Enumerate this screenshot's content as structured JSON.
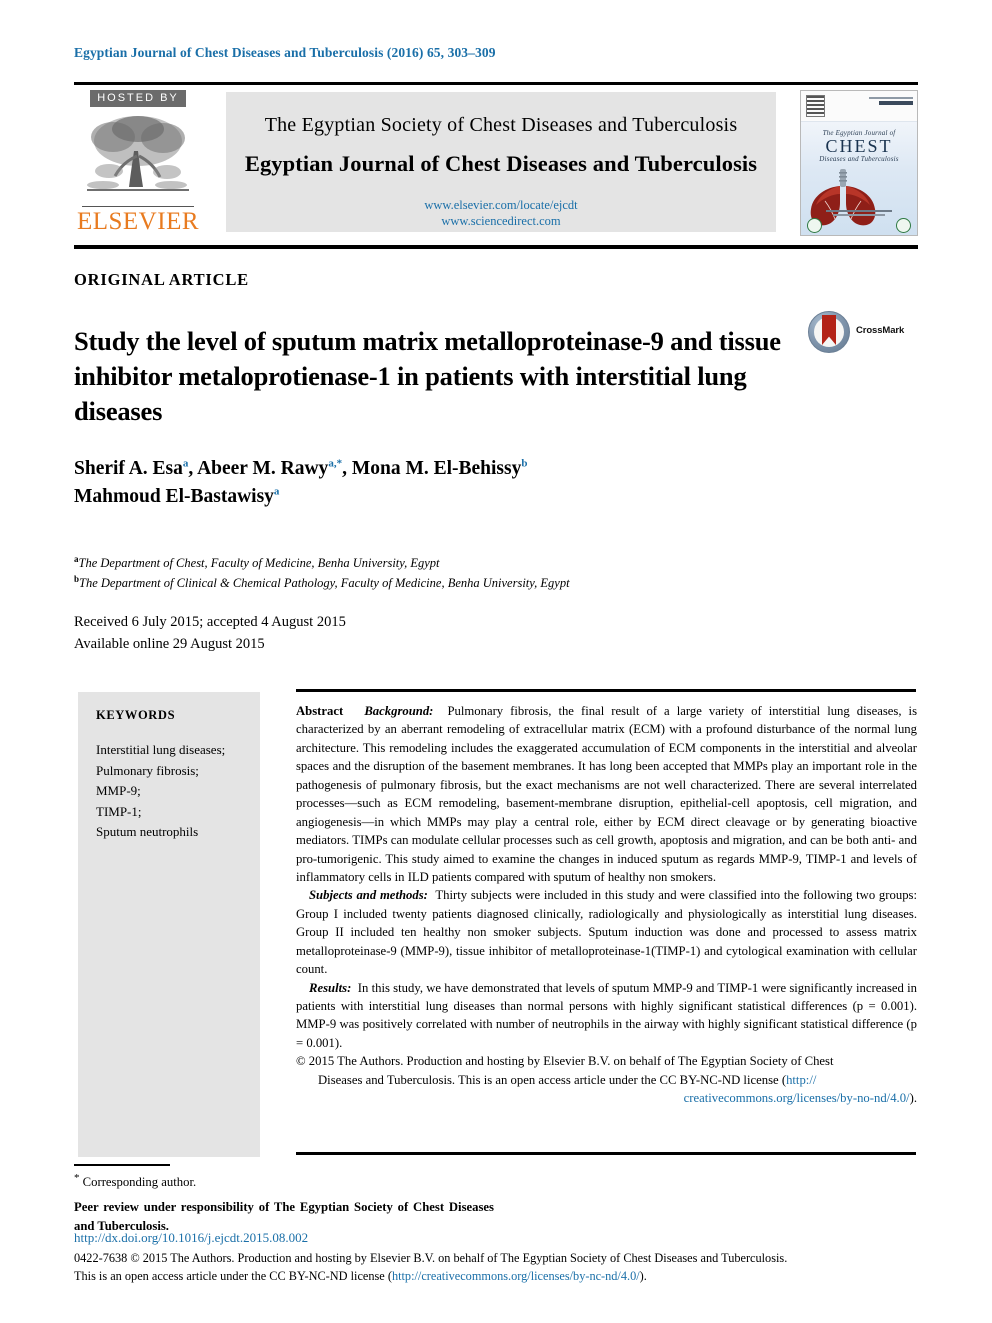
{
  "running_head": "Egyptian Journal of Chest Diseases and Tuberculosis (2016) 65, 303–309",
  "masthead": {
    "hosted_by": "HOSTED BY",
    "publisher": "ELSEVIER",
    "society_line": "The Egyptian Society of Chest Diseases and Tuberculosis",
    "journal_title": "Egyptian Journal of Chest Diseases and Tuberculosis",
    "link_locate": "www.elsevier.com/locate/ejcdt",
    "link_sciencedirect": "www.sciencedirect.com",
    "cover": {
      "line1": "The Egyptian Journal of",
      "line2": "CHEST",
      "line3": "Diseases and Tuberculosis"
    }
  },
  "article": {
    "type": "ORIGINAL ARTICLE",
    "title": "Study the level of sputum matrix metalloproteinase-9 and tissue inhibitor metaloprotienase-1 in patients with interstitial lung diseases",
    "crossmark_label": "CrossMark",
    "authors_line1_a": "Sherif A. Esa",
    "authors_line1_a_sup": "a",
    "authors_line1_b": ", Abeer M. Rawy",
    "authors_line1_b_sup": "a,*",
    "authors_line1_c": ", Mona M. El-Behissy",
    "authors_line1_c_sup": "b",
    "authors_line2": "Mahmoud El-Bastawisy",
    "authors_line2_sup": "a",
    "affiliation_a_sup": "a",
    "affiliation_a": "The Department of Chest, Faculty of Medicine, Benha University, Egypt",
    "affiliation_b_sup": "b",
    "affiliation_b": "The Department of Clinical & Chemical Pathology, Faculty of Medicine, Benha University, Egypt",
    "received": "Received 6 July 2015; accepted 4 August 2015",
    "available": "Available online 29 August 2015"
  },
  "keywords": {
    "heading": "KEYWORDS",
    "items": [
      "Interstitial lung diseases;",
      "Pulmonary fibrosis;",
      "MMP-9;",
      "TIMP-1;",
      "Sputum neutrophils"
    ]
  },
  "abstract": {
    "label": "Abstract",
    "background_label": "Background:",
    "background_text": "Pulmonary fibrosis, the final result of a large variety of interstitial lung diseases, is characterized by an aberrant remodeling of extracellular matrix (ECM) with a profound disturbance of the normal lung architecture. This remodeling includes the exaggerated accumulation of ECM components in the interstitial and alveolar spaces and the disruption of the basement membranes. It has long been accepted that MMPs play an important role in the pathogenesis of pulmonary fibrosis, but the exact mechanisms are not well characterized. There are several interrelated processes—such as ECM remodeling, basement-membrane disruption, epithelial-cell apoptosis, cell migration, and angiogenesis—in which MMPs may play a central role, either by ECM direct cleavage or by generating bioactive mediators. TIMPs can modulate cellular processes such as cell growth, apoptosis and migration, and can be both anti- and pro-tumorigenic. This study aimed to examine the changes in induced sputum as regards MMP-9, TIMP-1 and levels of inflammatory cells in ILD patients compared with sputum of healthy non smokers.",
    "methods_label": "Subjects and methods:",
    "methods_text": "Thirty subjects were included in this study and were classified into the following two groups: Group I included twenty patients diagnosed clinically, radiologically and physiologically as interstitial lung diseases. Group II included ten healthy non smoker subjects. Sputum induction was done and processed to assess matrix metalloproteinase-9 (MMP-9), tissue inhibitor of metalloproteinase-1(TIMP-1) and cytological examination with cellular count.",
    "results_label": "Results:",
    "results_text": "In this study, we have demonstrated that levels of sputum MMP-9 and TIMP-1 were significantly increased in patients with interstitial lung diseases than normal persons with highly significant statistical differences (p = 0.001). MMP-9 was positively correlated with number of neutrophils in the airway with highly significant statistical difference (p = 0.001).",
    "copyright_line1": "© 2015 The Authors. Production and hosting by Elsevier B.V. on behalf of The Egyptian Society of Chest",
    "copyright_line2": "Diseases and Tuberculosis. This is an open access article under the CC BY-NC-ND license (",
    "copyright_link1": "http://",
    "copyright_link2": "creativecommons.org/licenses/by-no-nd/4.0/",
    "copyright_end": ")."
  },
  "footer": {
    "corresponding_sup": "*",
    "corresponding": "Corresponding author.",
    "peer_review": "Peer review under responsibility of The Egyptian Society of Chest Diseases and Tuberculosis.",
    "doi": "http://dx.doi.org/10.1016/j.ejcdt.2015.08.002",
    "issn_line_a": "0422-7638 © 2015 The Authors. Production and hosting by Elsevier B.V. on behalf of The Egyptian Society of Chest Diseases and Tuberculosis.",
    "issn_line_b_pre": "This is an open access article under the CC BY-NC-ND license (",
    "issn_line_b_link": "http://creativecommons.org/licenses/by-nc-nd/4.0/",
    "issn_line_b_post": ")."
  },
  "colors": {
    "link_blue": "#1a6fa8",
    "elsevier_orange": "#e87b20",
    "panel_grey": "#e4e4e4",
    "hosted_grey": "#6b6b6b",
    "crossmark_red": "#b32317"
  }
}
